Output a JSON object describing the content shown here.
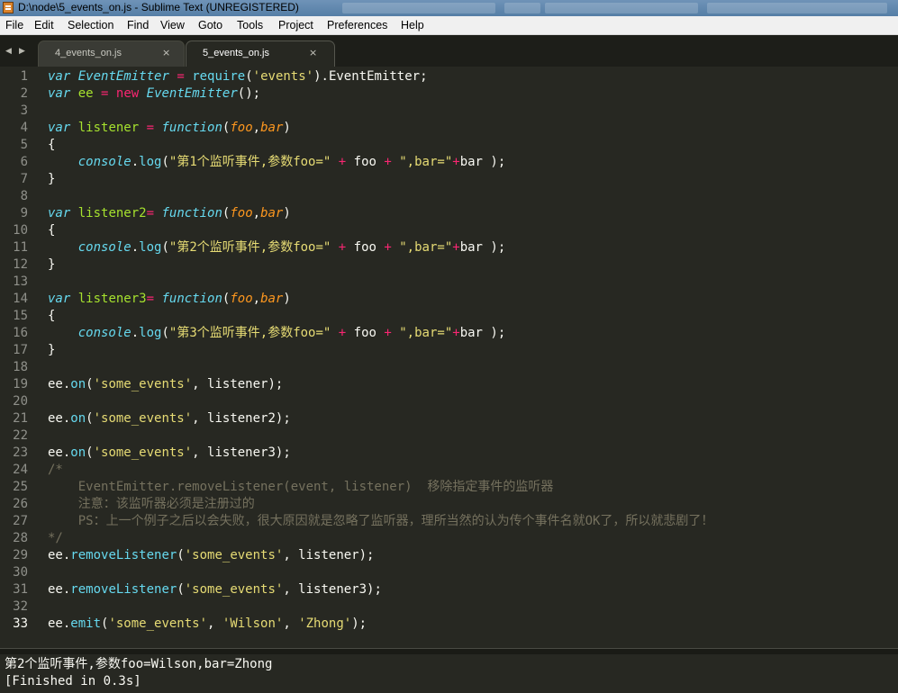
{
  "window": {
    "title": "D:\\node\\5_events_on.js - Sublime Text (UNREGISTERED)"
  },
  "menu": [
    "File",
    "Edit",
    "Selection",
    "Find",
    "View",
    "Goto",
    "Tools",
    "Project",
    "Preferences",
    "Help"
  ],
  "tabs": [
    {
      "label": "4_events_on.js",
      "active": false,
      "close": "×"
    },
    {
      "label": "5_events_on.js",
      "active": true,
      "close": "×"
    }
  ],
  "tab_nav": {
    "prev": "◀",
    "next": "▶"
  },
  "editor": {
    "current_line": 33,
    "lines": [
      "var EventEmitter = require('events').EventEmitter;",
      "var ee = new EventEmitter();",
      "",
      "var listener = function(foo,bar)",
      "{",
      "    console.log(\"第1个监听事件,参数foo=\" + foo + \",bar=\"+bar );",
      "}",
      "",
      "var listener2= function(foo,bar)",
      "{",
      "    console.log(\"第2个监听事件,参数foo=\" + foo + \",bar=\"+bar );",
      "}",
      "",
      "var listener3= function(foo,bar)",
      "{",
      "    console.log(\"第3个监听事件,参数foo=\" + foo + \",bar=\"+bar );",
      "}",
      "",
      "ee.on('some_events', listener);",
      "",
      "ee.on('some_events', listener2);",
      "",
      "ee.on('some_events', listener3);",
      "/*",
      "    EventEmitter.removeListener(event, listener)  移除指定事件的监听器",
      "    注意：该监听器必须是注册过的",
      "    PS：上一个例子之后以会失败，很大原因就是忽略了监听器，理所当然的认为传个事件名就OK了，所以就悲剧了！",
      "*/",
      "ee.removeListener('some_events', listener);",
      "",
      "ee.removeListener('some_events', listener3);",
      "",
      "ee.emit('some_events', 'Wilson', 'Zhong');"
    ]
  },
  "output": {
    "lines": [
      "第2个监听事件,参数foo=Wilson,bar=Zhong",
      "[Finished in 0.3s]"
    ]
  },
  "colors": {
    "background": "#272822",
    "keyword": "#66d9ef",
    "operator": "#f92672",
    "string": "#e6db74",
    "parameter": "#fd971f",
    "comment": "#75715e",
    "text": "#f8f8f2",
    "gutter": "#8f908a"
  }
}
